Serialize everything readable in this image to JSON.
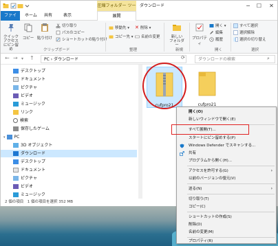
{
  "titlebar": {
    "compress_tab": "圧縮フォルダー ツール",
    "title": "ダウンロード",
    "min": "─",
    "max": "☐",
    "close": "✕"
  },
  "tabs": {
    "file": "ファイル",
    "home": "ホーム",
    "share": "共有",
    "view": "表示",
    "extract": "展開"
  },
  "ribbon": {
    "pin": "クイック アクセス\nにピン留め",
    "copy": "コピー",
    "paste": "貼り付け",
    "cut": "切り取り",
    "copy_path": "パスのコピー",
    "paste_shortcut": "ショートカットの貼り付け",
    "clipboard": "クリップボード",
    "move_to": "移動先",
    "copy_to": "コピー先",
    "delete": "削除",
    "rename": "名前の変更",
    "organize": "整理",
    "new_folder": "新しい\nフォルダー",
    "new": "新規",
    "properties": "プロパティ",
    "open": "開く",
    "edit": "編集",
    "history": "履歴",
    "open_group": "開く",
    "select_all": "すべて選択",
    "select_none": "選択解除",
    "invert": "選択の切り替え",
    "select": "選択"
  },
  "address": {
    "path": "PC › ダウンロード",
    "search_placeholder": "ダウンロードの検索"
  },
  "nav": [
    {
      "label": "デスクトップ"
    },
    {
      "label": "ドキュメント"
    },
    {
      "label": "ピクチャ"
    },
    {
      "label": "ビデオ"
    },
    {
      "label": "ミュージック"
    },
    {
      "label": "リンク"
    },
    {
      "label": "検索"
    },
    {
      "label": "保存したゲーム"
    },
    {
      "label": "PC"
    },
    {
      "label": "3D オブジェクト"
    },
    {
      "label": "ダウンロード"
    },
    {
      "label": "デスクトップ"
    },
    {
      "label": "ドキュメント"
    },
    {
      "label": "ピクチャ"
    },
    {
      "label": "ビデオ"
    },
    {
      "label": "ミュージック"
    }
  ],
  "files": [
    {
      "name": "cufpro21"
    },
    {
      "name": "cufpro21"
    }
  ],
  "status": "2 個の項目　1 個の項目を選択 352 MB",
  "context_menu": [
    {
      "label": "開く(O)",
      "bold": true
    },
    {
      "label": "新しいウィンドウで開く(E)"
    },
    {
      "label": "すべて展開(T)..."
    },
    {
      "label": "スタートにピン留めする(P)"
    },
    {
      "label": "Windows Defender でスキャンする..."
    },
    {
      "label": "共有"
    },
    {
      "label": "プログラムから開く(H)..."
    },
    {
      "label": "アクセスを許可する(G)"
    },
    {
      "label": "以前のバージョンの復元(V)"
    },
    {
      "label": "送る(N)"
    },
    {
      "label": "切り取り(T)"
    },
    {
      "label": "コピー(C)"
    },
    {
      "label": "ショートカットの作成(S)"
    },
    {
      "label": "削除(D)"
    },
    {
      "label": "名前の変更(M)"
    },
    {
      "label": "プロパティ(R)"
    }
  ],
  "colors": {
    "accent": "#1979ca",
    "highlight": "#e02020",
    "selection": "#cce8ff"
  }
}
